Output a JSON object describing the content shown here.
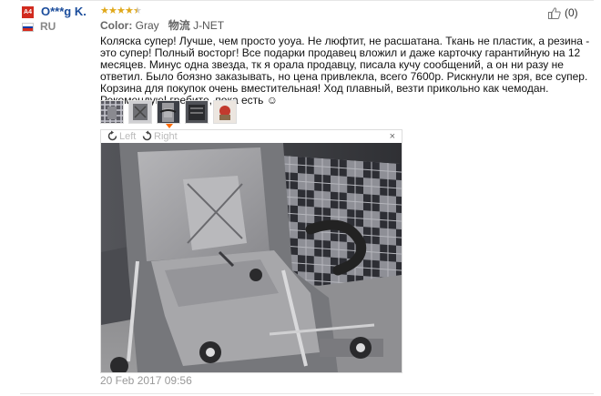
{
  "reviewer": {
    "avatar_text": "A4",
    "name": "O***g K.",
    "country": "RU",
    "flag_colors": [
      "#ffffff",
      "#0039a6",
      "#d52b1e"
    ]
  },
  "rating": {
    "value": 4.5,
    "max": 5,
    "color": "#e0a81a"
  },
  "attributes": {
    "color_label": "Color:",
    "color_value": "Gray",
    "shipping_label": "物流",
    "shipping_value": "J-NET"
  },
  "helpful": {
    "icon": "thumbs-up-icon",
    "count_text": "(0)"
  },
  "review": {
    "text": "Коляска супер! Лучше, чем просто yoya. Не люфтит, не расшатана. Ткань не пластик, а резина - это супер! Полный восторг! Все подарки продавец вложил и даже карточку гарантийную на 12 месяцев. Минус одна звезда, тк я орала продавцу, писала кучу сообщений, а он ни разу не ответил. Было боязно заказывать, но цена привлекла, всего 7600р. Рискнули не зря, все супер. Корзина для покупок очень вместительная! Ход плавный, везти прикольно как чемодан. Рекомендую! гребите, пока есть ☺"
  },
  "photos": {
    "count": 5,
    "active_index": 2,
    "viewer": {
      "rotate_left_label": "Left",
      "rotate_right_label": "Right",
      "close_label": "×"
    }
  },
  "date": "20 Feb 2017 09:56"
}
